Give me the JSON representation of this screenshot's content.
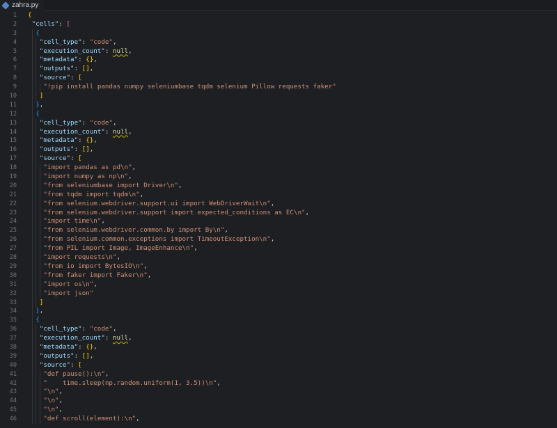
{
  "tab": {
    "filename": "zahra.py",
    "icon": "python-file-icon"
  },
  "lines": [
    {
      "no": "1",
      "indent": 0,
      "tokens": [
        {
          "t": "{",
          "c": "b1"
        }
      ]
    },
    {
      "no": "2",
      "indent": 1,
      "tokens": [
        {
          "t": "\"cells\"",
          "c": "k"
        },
        {
          "t": ": ",
          "c": "p"
        },
        {
          "t": "[",
          "c": "b2"
        }
      ]
    },
    {
      "no": "3",
      "indent": 2,
      "tokens": [
        {
          "t": "{",
          "c": "b3"
        }
      ]
    },
    {
      "no": "4",
      "indent": 3,
      "tokens": [
        {
          "t": "\"cell_type\"",
          "c": "k"
        },
        {
          "t": ": ",
          "c": "p"
        },
        {
          "t": "\"code\"",
          "c": "s"
        },
        {
          "t": ",",
          "c": "p"
        }
      ]
    },
    {
      "no": "5",
      "indent": 3,
      "tokens": [
        {
          "t": "\"execution_count\"",
          "c": "k"
        },
        {
          "t": ": ",
          "c": "p"
        },
        {
          "t": "null",
          "c": "n"
        },
        {
          "t": ",",
          "c": "p"
        }
      ]
    },
    {
      "no": "6",
      "indent": 3,
      "tokens": [
        {
          "t": "\"metadata\"",
          "c": "k"
        },
        {
          "t": ": ",
          "c": "p"
        },
        {
          "t": "{}",
          "c": "b1"
        },
        {
          "t": ",",
          "c": "p"
        }
      ]
    },
    {
      "no": "7",
      "indent": 3,
      "tokens": [
        {
          "t": "\"outputs\"",
          "c": "k"
        },
        {
          "t": ": ",
          "c": "p"
        },
        {
          "t": "[]",
          "c": "b1"
        },
        {
          "t": ",",
          "c": "p"
        }
      ]
    },
    {
      "no": "8",
      "indent": 3,
      "tokens": [
        {
          "t": "\"source\"",
          "c": "k"
        },
        {
          "t": ": ",
          "c": "p"
        },
        {
          "t": "[",
          "c": "b1"
        }
      ]
    },
    {
      "no": "9",
      "indent": 4,
      "tokens": [
        {
          "t": "\"!pip install pandas numpy seleniumbase tqdm selenium Pillow requests faker\"",
          "c": "s"
        }
      ]
    },
    {
      "no": "10",
      "indent": 3,
      "tokens": [
        {
          "t": "]",
          "c": "b1"
        }
      ]
    },
    {
      "no": "11",
      "indent": 2,
      "tokens": [
        {
          "t": "}",
          "c": "b3"
        },
        {
          "t": ",",
          "c": "p"
        }
      ]
    },
    {
      "no": "12",
      "indent": 2,
      "tokens": [
        {
          "t": "{",
          "c": "b3"
        }
      ]
    },
    {
      "no": "13",
      "indent": 3,
      "tokens": [
        {
          "t": "\"cell_type\"",
          "c": "k"
        },
        {
          "t": ": ",
          "c": "p"
        },
        {
          "t": "\"code\"",
          "c": "s"
        },
        {
          "t": ",",
          "c": "p"
        }
      ]
    },
    {
      "no": "14",
      "indent": 3,
      "tokens": [
        {
          "t": "\"execution_count\"",
          "c": "k"
        },
        {
          "t": ": ",
          "c": "p"
        },
        {
          "t": "null",
          "c": "n"
        },
        {
          "t": ",",
          "c": "p"
        }
      ]
    },
    {
      "no": "15",
      "indent": 3,
      "tokens": [
        {
          "t": "\"metadata\"",
          "c": "k"
        },
        {
          "t": ": ",
          "c": "p"
        },
        {
          "t": "{}",
          "c": "b1"
        },
        {
          "t": ",",
          "c": "p"
        }
      ]
    },
    {
      "no": "16",
      "indent": 3,
      "tokens": [
        {
          "t": "\"outputs\"",
          "c": "k"
        },
        {
          "t": ": ",
          "c": "p"
        },
        {
          "t": "[]",
          "c": "b1"
        },
        {
          "t": ",",
          "c": "p"
        }
      ]
    },
    {
      "no": "17",
      "indent": 3,
      "tokens": [
        {
          "t": "\"source\"",
          "c": "k"
        },
        {
          "t": ": ",
          "c": "p"
        },
        {
          "t": "[",
          "c": "b1"
        }
      ]
    },
    {
      "no": "18",
      "indent": 4,
      "tokens": [
        {
          "t": "\"import pandas as pd\\n\"",
          "c": "s"
        },
        {
          "t": ",",
          "c": "p"
        }
      ]
    },
    {
      "no": "19",
      "indent": 4,
      "tokens": [
        {
          "t": "\"import numpy as np\\n\"",
          "c": "s"
        },
        {
          "t": ",",
          "c": "p"
        }
      ]
    },
    {
      "no": "20",
      "indent": 4,
      "tokens": [
        {
          "t": "\"from seleniumbase import Driver\\n\"",
          "c": "s"
        },
        {
          "t": ",",
          "c": "p"
        }
      ]
    },
    {
      "no": "21",
      "indent": 4,
      "tokens": [
        {
          "t": "\"from tqdm import tqdm\\n\"",
          "c": "s"
        },
        {
          "t": ",",
          "c": "p"
        }
      ]
    },
    {
      "no": "22",
      "indent": 4,
      "tokens": [
        {
          "t": "\"from selenium.webdriver.support.ui import WebDriverWait\\n\"",
          "c": "s"
        },
        {
          "t": ",",
          "c": "p"
        }
      ]
    },
    {
      "no": "23",
      "indent": 4,
      "tokens": [
        {
          "t": "\"from selenium.webdriver.support import expected_conditions as EC\\n\"",
          "c": "s"
        },
        {
          "t": ",",
          "c": "p"
        }
      ]
    },
    {
      "no": "24",
      "indent": 4,
      "tokens": [
        {
          "t": "\"import time\\n\"",
          "c": "s"
        },
        {
          "t": ",",
          "c": "p"
        }
      ]
    },
    {
      "no": "25",
      "indent": 4,
      "tokens": [
        {
          "t": "\"from selenium.webdriver.common.by import By\\n\"",
          "c": "s"
        },
        {
          "t": ",",
          "c": "p"
        }
      ]
    },
    {
      "no": "26",
      "indent": 4,
      "tokens": [
        {
          "t": "\"from selenium.common.exceptions import TimeoutException\\n\"",
          "c": "s"
        },
        {
          "t": ",",
          "c": "p"
        }
      ]
    },
    {
      "no": "27",
      "indent": 4,
      "tokens": [
        {
          "t": "\"from PIL import Image, ImageEnhance\\n\"",
          "c": "s"
        },
        {
          "t": ",",
          "c": "p"
        }
      ]
    },
    {
      "no": "28",
      "indent": 4,
      "tokens": [
        {
          "t": "\"import requests\\n\"",
          "c": "s"
        },
        {
          "t": ",",
          "c": "p"
        }
      ]
    },
    {
      "no": "29",
      "indent": 4,
      "tokens": [
        {
          "t": "\"from io import BytesIO\\n\"",
          "c": "s"
        },
        {
          "t": ",",
          "c": "p"
        }
      ]
    },
    {
      "no": "30",
      "indent": 4,
      "tokens": [
        {
          "t": "\"from faker import Faker\\n\"",
          "c": "s"
        },
        {
          "t": ",",
          "c": "p"
        }
      ]
    },
    {
      "no": "31",
      "indent": 4,
      "tokens": [
        {
          "t": "\"import os\\n\"",
          "c": "s"
        },
        {
          "t": ",",
          "c": "p"
        }
      ]
    },
    {
      "no": "32",
      "indent": 4,
      "tokens": [
        {
          "t": "\"import json\"",
          "c": "s"
        }
      ]
    },
    {
      "no": "33",
      "indent": 3,
      "tokens": [
        {
          "t": "]",
          "c": "b1"
        }
      ]
    },
    {
      "no": "34",
      "indent": 2,
      "tokens": [
        {
          "t": "}",
          "c": "b3"
        },
        {
          "t": ",",
          "c": "p"
        }
      ]
    },
    {
      "no": "35",
      "indent": 2,
      "tokens": [
        {
          "t": "{",
          "c": "b3"
        }
      ]
    },
    {
      "no": "36",
      "indent": 3,
      "tokens": [
        {
          "t": "\"cell_type\"",
          "c": "k"
        },
        {
          "t": ": ",
          "c": "p"
        },
        {
          "t": "\"code\"",
          "c": "s"
        },
        {
          "t": ",",
          "c": "p"
        }
      ]
    },
    {
      "no": "37",
      "indent": 3,
      "tokens": [
        {
          "t": "\"execution_count\"",
          "c": "k"
        },
        {
          "t": ": ",
          "c": "p"
        },
        {
          "t": "null",
          "c": "n"
        },
        {
          "t": ",",
          "c": "p"
        }
      ]
    },
    {
      "no": "38",
      "indent": 3,
      "tokens": [
        {
          "t": "\"metadata\"",
          "c": "k"
        },
        {
          "t": ": ",
          "c": "p"
        },
        {
          "t": "{}",
          "c": "b1"
        },
        {
          "t": ",",
          "c": "p"
        }
      ]
    },
    {
      "no": "39",
      "indent": 3,
      "tokens": [
        {
          "t": "\"outputs\"",
          "c": "k"
        },
        {
          "t": ": ",
          "c": "p"
        },
        {
          "t": "[]",
          "c": "b1"
        },
        {
          "t": ",",
          "c": "p"
        }
      ]
    },
    {
      "no": "40",
      "indent": 3,
      "tokens": [
        {
          "t": "\"source\"",
          "c": "k"
        },
        {
          "t": ": ",
          "c": "p"
        },
        {
          "t": "[",
          "c": "b1"
        }
      ]
    },
    {
      "no": "41",
      "indent": 4,
      "tokens": [
        {
          "t": "\"def pause():\\n\"",
          "c": "s"
        },
        {
          "t": ",",
          "c": "p"
        }
      ]
    },
    {
      "no": "42",
      "indent": 4,
      "tokens": [
        {
          "t": "\"    time.sleep(np.random.uniform(1, 3.5))\\n\"",
          "c": "s"
        },
        {
          "t": ",",
          "c": "p"
        }
      ]
    },
    {
      "no": "43",
      "indent": 4,
      "tokens": [
        {
          "t": "\"\\n\"",
          "c": "s"
        },
        {
          "t": ",",
          "c": "p"
        }
      ]
    },
    {
      "no": "44",
      "indent": 4,
      "tokens": [
        {
          "t": "\"\\n\"",
          "c": "s"
        },
        {
          "t": ",",
          "c": "p"
        }
      ]
    },
    {
      "no": "45",
      "indent": 4,
      "tokens": [
        {
          "t": "\"\\n\"",
          "c": "s"
        },
        {
          "t": ",",
          "c": "p"
        }
      ]
    },
    {
      "no": "46",
      "indent": 4,
      "tokens": [
        {
          "t": "\"def scroll(element):\\n\"",
          "c": "s"
        },
        {
          "t": ",",
          "c": "p"
        }
      ]
    }
  ]
}
